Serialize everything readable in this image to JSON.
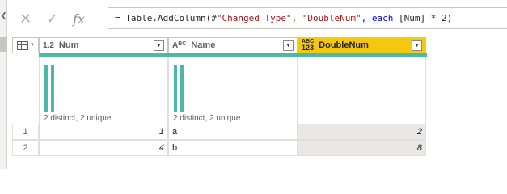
{
  "formula_bar": {
    "cancel_icon": "x-icon",
    "commit_icon": "check-icon",
    "fx_label": "fx",
    "formula_prefix": "= Table.AddColumn(#",
    "formula_str1": "\"Changed Type\"",
    "formula_sep1": ", ",
    "formula_str2": "\"DoubleNum\"",
    "formula_sep2": ", ",
    "formula_kw": "each",
    "formula_rest": " [Num] * 2)"
  },
  "columns": [
    {
      "type_label": "1.2",
      "name": "Num",
      "distinct": "2 distinct, 2 unique"
    },
    {
      "type_label": "ABC",
      "name": "Name",
      "distinct": "2 distinct, 2 unique"
    },
    {
      "type_label": "ABC 123",
      "name": "DoubleNum",
      "distinct": ""
    }
  ],
  "rows": [
    {
      "row_num": "1",
      "num": "1",
      "name": "a",
      "double": "2"
    },
    {
      "row_num": "2",
      "num": "4",
      "name": "b",
      "double": "8"
    }
  ],
  "colors": {
    "active_header": "#f2c811",
    "quality_bar": "#4cb8a6",
    "shaded_cell": "#e9e8e7"
  }
}
